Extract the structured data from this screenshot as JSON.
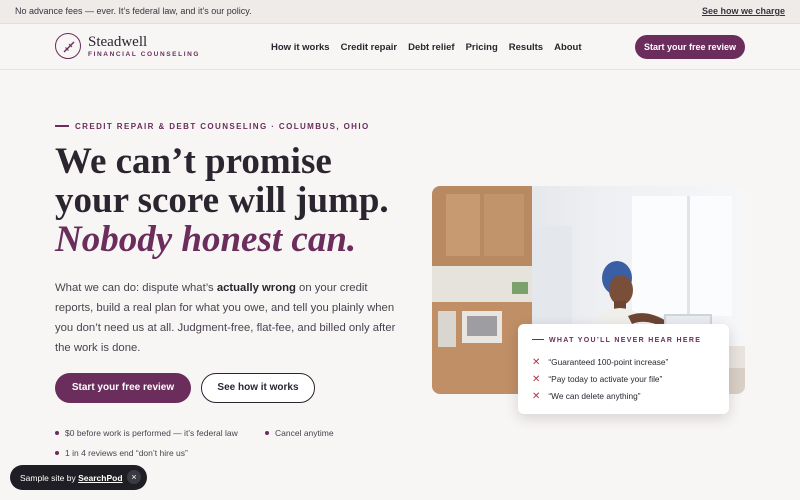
{
  "topbar": {
    "note": "No advance fees — ever. It’s federal law, and it’s our policy.",
    "link": "See how we charge"
  },
  "brand": {
    "name": "Steadwell",
    "sub": "FINANCIAL COUNSELING"
  },
  "nav": {
    "links": [
      "How it works",
      "Credit repair",
      "Debt relief",
      "Pricing",
      "Results",
      "About"
    ],
    "cta": "Start your free review"
  },
  "hero": {
    "eyebrow": "CREDIT REPAIR & DEBT COUNSELING · COLUMBUS, OHIO",
    "line1": "We can’t promise",
    "line2": "your score will jump.",
    "line3": "Nobody honest can.",
    "p_before": "What we can do: dispute what’s ",
    "p_bold": "actually wrong",
    "p_after": " on your credit reports, build a real plan for what you owe, and tell you plainly when you don’t need us at all. Judgment-free, flat-fee, and billed only after the work is done.",
    "btn_primary": "Start your free review",
    "btn_secondary": "See how it works",
    "bullets": [
      "$0 before work is performed — it’s federal law",
      "Cancel anytime",
      "1 in 4 reviews end “don’t hire us”"
    ]
  },
  "card": {
    "title": "WHAT YOU’LL NEVER HEAR HERE",
    "items": [
      "“Guaranteed 100-point increase”",
      "“Pay today to activate your file”",
      "“We can delete anything”"
    ]
  },
  "toast": {
    "prefix": "Sample site by ",
    "brand": "SearchPod",
    "close": "×"
  },
  "colors": {
    "accent": "#6a2d5c",
    "text": "#2b2530",
    "background": "#f8f6f4",
    "x_mark": "#b5324a"
  },
  "icons": [
    "logo-mark-icon",
    "x-mark-icon",
    "close-icon"
  ]
}
